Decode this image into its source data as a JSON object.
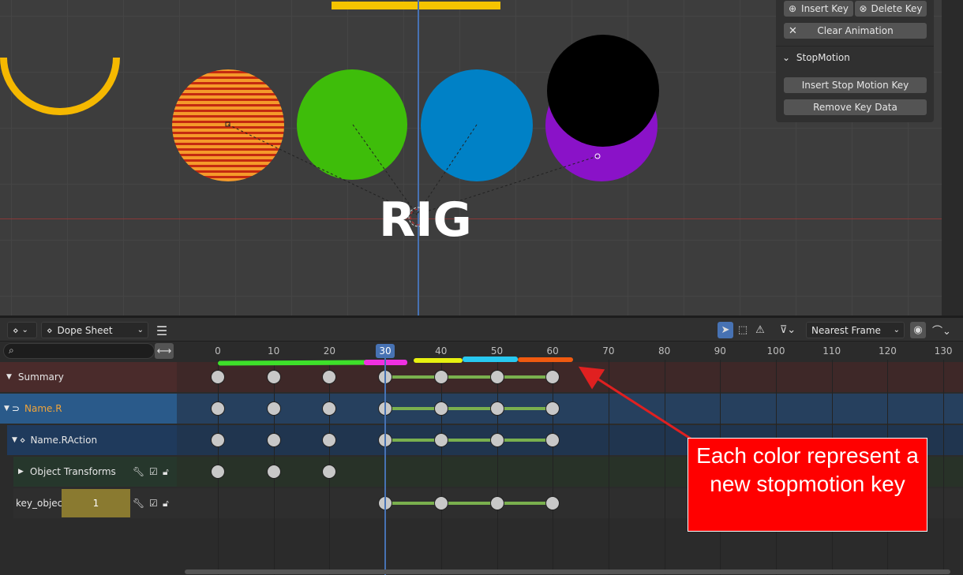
{
  "viewport": {
    "label_text": "RIG",
    "colors": {
      "orange": "#f59a2a",
      "green": "#3ebd0a",
      "blue": "#0081c6",
      "purple": "#8a12c8",
      "black": "#000000",
      "yellow": "#f5c400"
    }
  },
  "npanel": {
    "insert_key": "Insert Key",
    "delete_key": "Delete Key",
    "clear_animation": "Clear Animation",
    "section_title": "StopMotion",
    "insert_stop_motion_key": "Insert Stop Motion Key",
    "remove_key_data": "Remove Key Data"
  },
  "dopesheet": {
    "editor_type_icon": "dope-sheet-icon",
    "mode_label": "Dope Sheet",
    "snap_label": "Nearest Frame",
    "current_frame": "30",
    "frame_numbers": [
      "0",
      "10",
      "20",
      "30",
      "40",
      "50",
      "60",
      "70",
      "80",
      "90",
      "100",
      "110",
      "120",
      "130"
    ],
    "channels": {
      "summary": "Summary",
      "object": "Name.R",
      "action": "Name.RAction",
      "group": "Object Transforms",
      "property": "key_object",
      "property_value": "1"
    },
    "keyframes": {
      "summary": [
        0,
        10,
        20,
        30,
        40,
        50,
        60
      ],
      "object": [
        0,
        10,
        20,
        30,
        40,
        50,
        60
      ],
      "action": [
        0,
        10,
        20,
        30,
        40,
        50,
        60
      ],
      "group": [
        0,
        10,
        20
      ],
      "property": [
        30,
        40,
        50,
        60
      ]
    },
    "holds": {
      "start": 30,
      "end": 60
    }
  },
  "annotation": {
    "text": "Each color represent a new stopmotion key",
    "color": "#ff0000"
  }
}
